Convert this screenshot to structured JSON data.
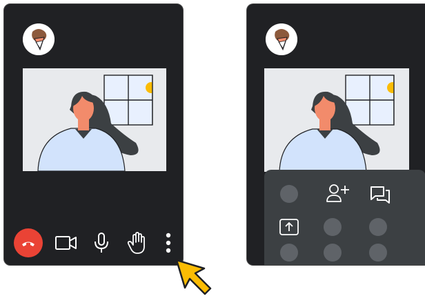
{
  "call_left": {
    "controls": [
      {
        "icon": "end-call-icon"
      },
      {
        "icon": "camera-icon"
      },
      {
        "icon": "microphone-icon"
      },
      {
        "icon": "raise-hand-icon"
      },
      {
        "icon": "more-options-icon"
      }
    ]
  },
  "call_right": {
    "more_menu": {
      "icons": [
        "add-people-icon",
        "chat-icon",
        "present-screen-icon"
      ]
    }
  },
  "colors": {
    "window_bg": "#202124",
    "sheet_bg": "#3c4043",
    "end_call": "#ea4335",
    "pointer": "#fbbc04",
    "video_bg": "#e8eaed"
  }
}
